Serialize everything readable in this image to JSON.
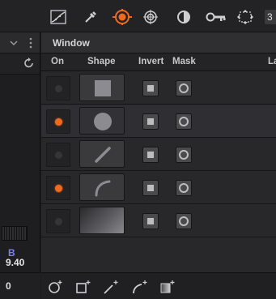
{
  "toolbar": {
    "icons": [
      "curves-icon",
      "eyedropper-icon",
      "window-icon",
      "tracker-icon",
      "blur-icon",
      "key-icon",
      "resize-icon"
    ],
    "active_icon": "window-icon",
    "page_number": "3",
    "accent_color": "#f06a1e"
  },
  "left_panel": {
    "value_a": "B",
    "value_b": "9.40",
    "bottom_value": "0",
    "wheel_color": "#7a3fe0"
  },
  "window_panel": {
    "title": "Window",
    "columns": {
      "on": "On",
      "shape": "Shape",
      "invert": "Invert",
      "mask": "Mask",
      "layer": "La"
    },
    "rows": [
      {
        "shape": "square-shape-icon",
        "enabled": false
      },
      {
        "shape": "circle-shape-icon",
        "enabled": true
      },
      {
        "shape": "linear-shape-icon",
        "enabled": false
      },
      {
        "shape": "curve-shape-icon",
        "enabled": true
      },
      {
        "shape": "gradient-shape-icon",
        "enabled": false
      }
    ]
  },
  "bottom_tools": [
    "add-circle-window-icon",
    "add-square-window-icon",
    "add-linear-window-icon",
    "add-curve-window-icon",
    "add-gradient-window-icon"
  ]
}
